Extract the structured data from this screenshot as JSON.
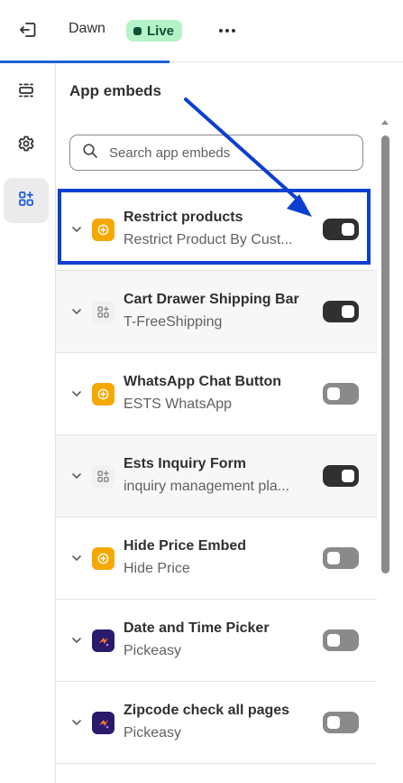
{
  "topbar": {
    "theme_name": "Dawn",
    "status_badge": "Live",
    "exit_icon": "exit-icon",
    "more_icon": "more-horizontal-icon"
  },
  "rail": {
    "items": [
      {
        "icon": "sections-icon",
        "active": false
      },
      {
        "icon": "settings-gear-icon",
        "active": false
      },
      {
        "icon": "app-embeds-icon",
        "active": true
      }
    ]
  },
  "panel": {
    "title": "App embeds",
    "search": {
      "placeholder": "Search app embeds",
      "value": ""
    }
  },
  "embeds": [
    {
      "name": "Restrict products",
      "app": "Restrict Product By Cust...",
      "icon": "yellow",
      "enabled": true
    },
    {
      "name": "Cart Drawer Shipping Bar",
      "app": "T-FreeShipping",
      "icon": "gray",
      "enabled": true
    },
    {
      "name": "WhatsApp Chat Button",
      "app": "ESTS WhatsApp",
      "icon": "yellow",
      "enabled": false
    },
    {
      "name": "Ests Inquiry Form",
      "app": "inquiry management pla...",
      "icon": "gray",
      "enabled": true
    },
    {
      "name": "Hide Price Embed",
      "app": "Hide Price",
      "icon": "yellow",
      "enabled": false
    },
    {
      "name": "Date and Time Picker",
      "app": "Pickeasy",
      "icon": "purple",
      "enabled": false
    },
    {
      "name": "Zipcode check all pages",
      "app": "Pickeasy",
      "icon": "purple",
      "enabled": false
    }
  ],
  "colors": {
    "accent": "#1c5fd6",
    "annotation": "#0b3fd1",
    "toggle_on": "#303030",
    "toggle_off": "#8a8a8a",
    "live_badge_bg": "#b4f2c8"
  }
}
